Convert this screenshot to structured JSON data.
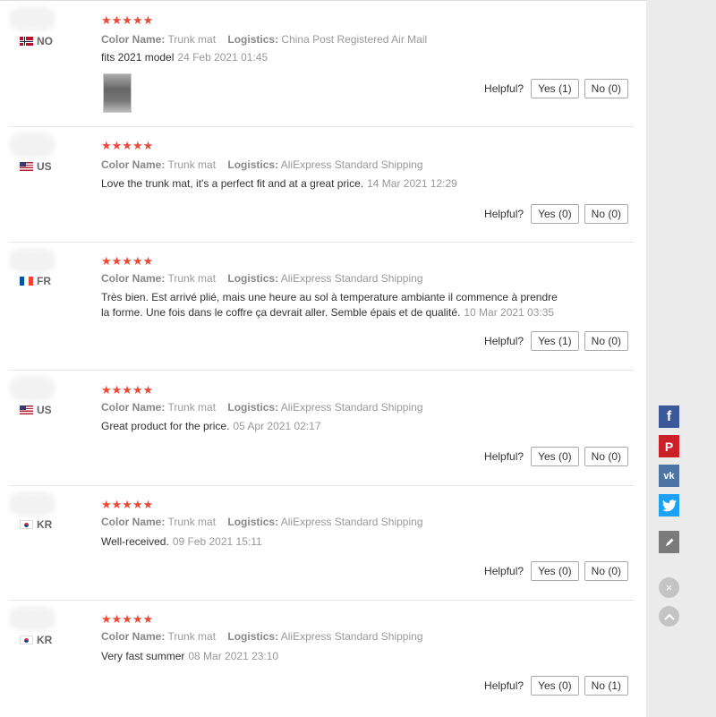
{
  "reviews": [
    {
      "country": "NO",
      "stars": "★★★★★",
      "color_label": "Color Name:",
      "color_value": "Trunk mat",
      "logistics_label": "Logistics:",
      "logistics_value": "China Post Registered Air Mail",
      "text": "fits 2021 model",
      "date": "24 Feb 2021 01:45",
      "has_image": true,
      "helpful_label": "Helpful?",
      "yes": "Yes (1)",
      "no": "No (0)"
    },
    {
      "country": "US",
      "stars": "★★★★★",
      "color_label": "Color Name:",
      "color_value": "Trunk mat",
      "logistics_label": "Logistics:",
      "logistics_value": "AliExpress Standard Shipping",
      "text": "Love the trunk mat, it's a perfect fit and at a great price.",
      "date": "14 Mar 2021 12:29",
      "helpful_label": "Helpful?",
      "yes": "Yes (0)",
      "no": "No (0)"
    },
    {
      "country": "FR",
      "stars": "★★★★★",
      "color_label": "Color Name:",
      "color_value": "Trunk mat",
      "logistics_label": "Logistics:",
      "logistics_value": "AliExpress Standard Shipping",
      "text": "Très bien. Est arrivé plié, mais une heure au sol à temperature ambiante il commence à prendre la forme. Une fois dans le coffre ça devrait aller. Semble épais et de qualité.",
      "date": "10 Mar 2021 03:35",
      "helpful_label": "Helpful?",
      "yes": "Yes (1)",
      "no": "No (0)"
    },
    {
      "country": "US",
      "stars": "★★★★★",
      "color_label": "Color Name:",
      "color_value": "Trunk mat",
      "logistics_label": "Logistics:",
      "logistics_value": "AliExpress Standard Shipping",
      "text": "Great product for the price.",
      "date": "05 Apr 2021 02:17",
      "helpful_label": "Helpful?",
      "yes": "Yes (0)",
      "no": "No (0)"
    },
    {
      "country": "KR",
      "stars": "★★★★★",
      "color_label": "Color Name:",
      "color_value": "Trunk mat",
      "logistics_label": "Logistics:",
      "logistics_value": "AliExpress Standard Shipping",
      "text": "Well-received.",
      "date": "09 Feb 2021 15:11",
      "helpful_label": "Helpful?",
      "yes": "Yes (0)",
      "no": "No (0)"
    },
    {
      "country": "KR",
      "stars": "★★★★★",
      "color_label": "Color Name:",
      "color_value": "Trunk mat",
      "logistics_label": "Logistics:",
      "logistics_value": "AliExpress Standard Shipping",
      "text": "Very fast summer",
      "date": "08 Mar 2021 23:10",
      "helpful_label": "Helpful?",
      "yes": "Yes (0)",
      "no": "No (1)"
    }
  ],
  "share": {
    "facebook": "f",
    "pinterest": "P",
    "vk": "vk",
    "twitter": "twitter-icon",
    "edit": "pencil-icon",
    "close": "×",
    "up": "^"
  },
  "colors": {
    "star": "#e94a3b",
    "facebook": "#3b5998",
    "pinterest": "#cb2027",
    "vk": "#4c75a3",
    "twitter": "#1da1f2",
    "edit": "#7b7b7b"
  }
}
